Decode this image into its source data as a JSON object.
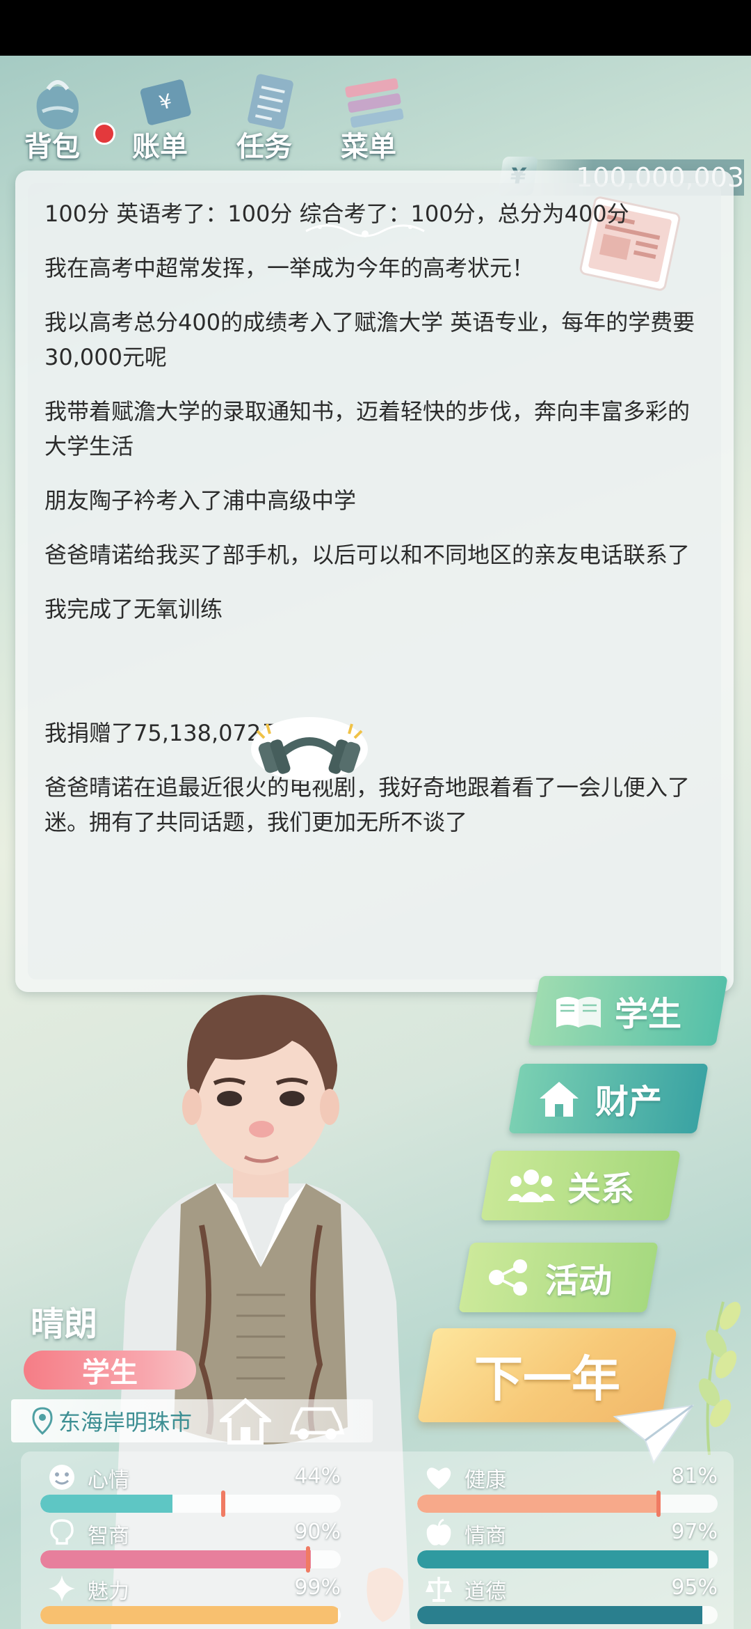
{
  "toolbar": {
    "items": [
      {
        "label": "背包",
        "icon": "backpack-icon"
      },
      {
        "label": "账单",
        "icon": "bill-icon"
      },
      {
        "label": "任务",
        "icon": "task-icon"
      },
      {
        "label": "菜单",
        "icon": "menu-icon"
      }
    ],
    "currency_symbol": "¥",
    "money": "100,000,003"
  },
  "story": {
    "paragraphs": [
      "100分  英语考了：100分  综合考了：100分，总分为400分",
      "我在高考中超常发挥，一举成为今年的高考状元！",
      "我以高考总分400的成绩考入了赋澹大学  英语专业，每年的学费要30,000元呢",
      "我带着赋澹大学的录取通知书，迈着轻快的步伐，奔向丰富多彩的大学生活",
      "朋友陶子衿考入了浦中高级中学",
      "爸爸晴诺给我买了部手机，以后可以和不同地区的亲友电话联系了",
      "我完成了无氧训练",
      "我捐赠了75,138,072元",
      "爸爸晴诺在追最近很火的电视剧，我好奇地跟着看了一会儿便入了迷。拥有了共同话题，我们更加无所不谈了"
    ]
  },
  "categories": {
    "student": "学生",
    "assets": "财产",
    "relations": "关系",
    "activities": "活动"
  },
  "next_year": "下一年",
  "character": {
    "name": "晴朗",
    "role": "学生",
    "location": "东海岸明珠市"
  },
  "stats": [
    {
      "name": "心情",
      "value": 44,
      "display": "44%",
      "icon": "smiley-icon",
      "color": "#5ec6c4"
    },
    {
      "name": "健康",
      "value": 81,
      "display": "81%",
      "icon": "heart-icon",
      "color": "#f7a98a"
    },
    {
      "name": "智商",
      "value": 90,
      "display": "90%",
      "icon": "bulb-icon",
      "color": "#e77f9c"
    },
    {
      "name": "情商",
      "value": 97,
      "display": "97%",
      "icon": "apple-icon",
      "color": "#2f9aa0"
    },
    {
      "name": "魅力",
      "value": 99,
      "display": "99%",
      "icon": "sparkle-icon",
      "color": "#f8c06f"
    },
    {
      "name": "道德",
      "value": 95,
      "display": "95%",
      "icon": "scale-icon",
      "color": "#2a7f8e"
    }
  ]
}
